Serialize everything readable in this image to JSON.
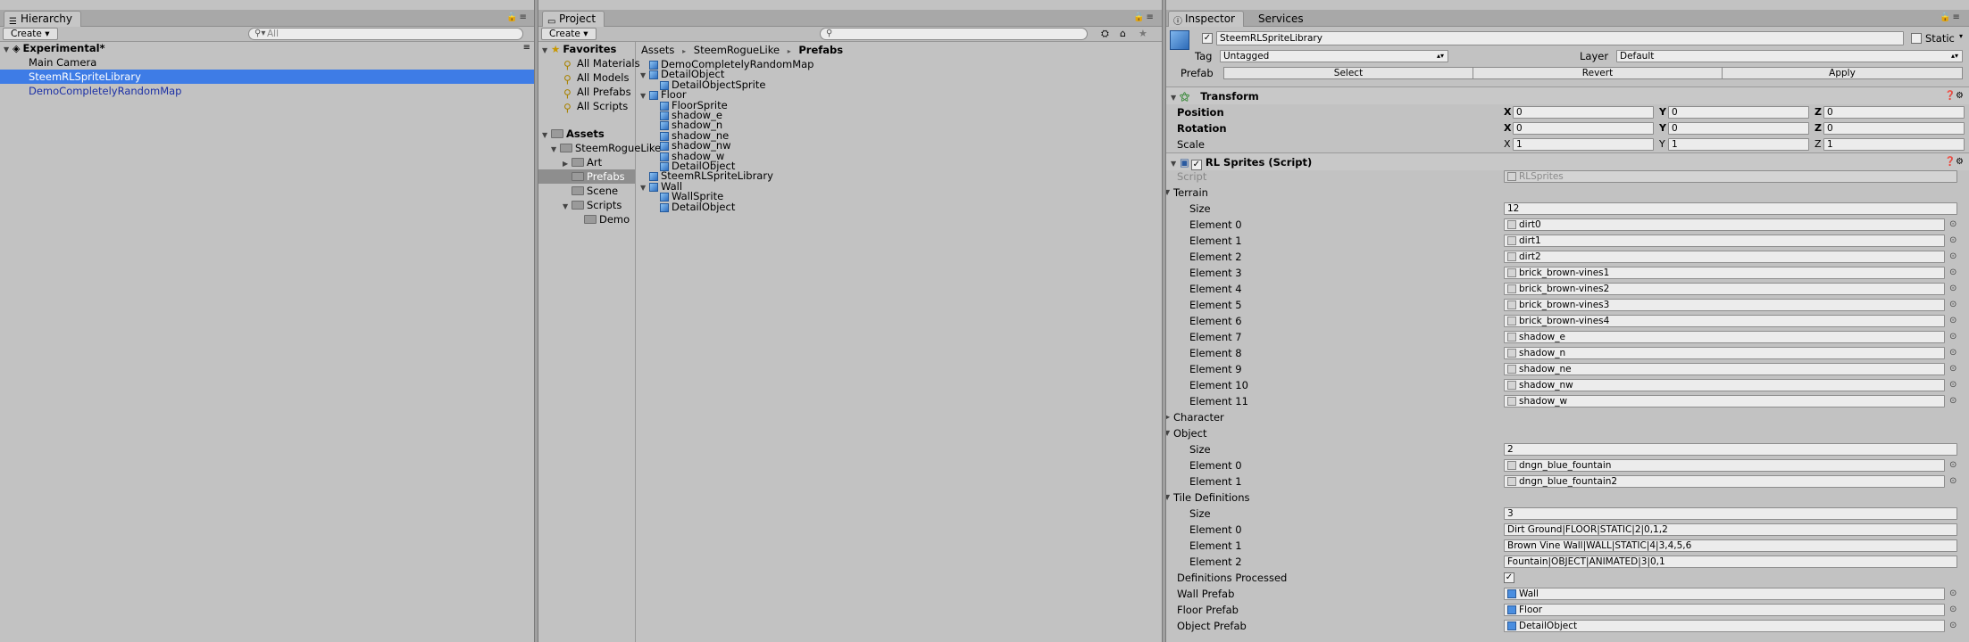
{
  "hierarchy": {
    "tab": "Hierarchy",
    "create": "Create",
    "search_placeholder": "All",
    "scene": "Experimental*",
    "items": [
      "Main Camera",
      "SteemRLSpriteLibrary",
      "DemoCompletelyRandomMap"
    ]
  },
  "project": {
    "tab": "Project",
    "create": "Create",
    "favorites": {
      "label": "Favorites",
      "items": [
        "All Materials",
        "All Models",
        "All Prefabs",
        "All Scripts"
      ]
    },
    "assets": {
      "label": "Assets",
      "root": "SteemRogueLike",
      "folders": [
        "Art",
        "Prefabs",
        "Scene",
        "Scripts"
      ],
      "scripts_child": "Demo"
    },
    "breadcrumb": [
      "Assets",
      "SteemRogueLike",
      "Prefabs"
    ],
    "tree": [
      {
        "label": "DemoCompletelyRandomMap",
        "depth": 0,
        "arrow": false
      },
      {
        "label": "DetailObject",
        "depth": 0,
        "arrow": true
      },
      {
        "label": "DetailObjectSprite",
        "depth": 1,
        "arrow": false
      },
      {
        "label": "Floor",
        "depth": 0,
        "arrow": true
      },
      {
        "label": "FloorSprite",
        "depth": 1,
        "arrow": false
      },
      {
        "label": "shadow_e",
        "depth": 1,
        "arrow": false
      },
      {
        "label": "shadow_n",
        "depth": 1,
        "arrow": false
      },
      {
        "label": "shadow_ne",
        "depth": 1,
        "arrow": false
      },
      {
        "label": "shadow_nw",
        "depth": 1,
        "arrow": false
      },
      {
        "label": "shadow_w",
        "depth": 1,
        "arrow": false
      },
      {
        "label": "DetailObject",
        "depth": 1,
        "arrow": false
      },
      {
        "label": "SteemRLSpriteLibrary",
        "depth": 0,
        "arrow": false
      },
      {
        "label": "Wall",
        "depth": 0,
        "arrow": true
      },
      {
        "label": "WallSprite",
        "depth": 1,
        "arrow": false
      },
      {
        "label": "DetailObject",
        "depth": 1,
        "arrow": false
      }
    ]
  },
  "inspector": {
    "tabs": [
      "Inspector",
      "Services"
    ],
    "object_name": "SteemRLSpriteLibrary",
    "static_label": "Static",
    "tag_label": "Tag",
    "tag_value": "Untagged",
    "layer_label": "Layer",
    "layer_value": "Default",
    "prefab_label": "Prefab",
    "prefab_buttons": [
      "Select",
      "Revert",
      "Apply"
    ],
    "transform": {
      "title": "Transform",
      "rows": [
        {
          "label": "Position",
          "x": "0",
          "y": "0",
          "z": "0",
          "bold": true
        },
        {
          "label": "Rotation",
          "x": "0",
          "y": "0",
          "z": "0",
          "bold": true
        },
        {
          "label": "Scale",
          "x": "1",
          "y": "1",
          "z": "1",
          "bold": false
        }
      ]
    },
    "script_component": {
      "title": "RL Sprites (Script)",
      "script_label": "Script",
      "script_value": "RLSprites",
      "terrain": {
        "label": "Terrain",
        "size_label": "Size",
        "size": "12",
        "elements": [
          "dirt0",
          "dirt1",
          "dirt2",
          "brick_brown-vines1",
          "brick_brown-vines2",
          "brick_brown-vines3",
          "brick_brown-vines4",
          "shadow_e",
          "shadow_n",
          "shadow_ne",
          "shadow_nw",
          "shadow_w"
        ]
      },
      "character_label": "Character",
      "object": {
        "label": "Object",
        "size_label": "Size",
        "size": "2",
        "elements": [
          "dngn_blue_fountain",
          "dngn_blue_fountain2"
        ]
      },
      "tile_definitions": {
        "label": "Tile Definitions",
        "size_label": "Size",
        "size": "3",
        "elements": [
          "Dirt Ground|FLOOR|STATIC|2|0,1,2",
          "Brown Vine Wall|WALL|STATIC|4|3,4,5,6",
          "Fountain|OBJECT|ANIMATED|3|0,1"
        ]
      },
      "definitions_processed_label": "Definitions Processed",
      "wall_prefab_label": "Wall Prefab",
      "wall_prefab": "Wall",
      "floor_prefab_label": "Floor Prefab",
      "floor_prefab": "Floor",
      "object_prefab_label": "Object Prefab",
      "object_prefab": "DetailObject"
    },
    "element_prefix": "Element"
  }
}
